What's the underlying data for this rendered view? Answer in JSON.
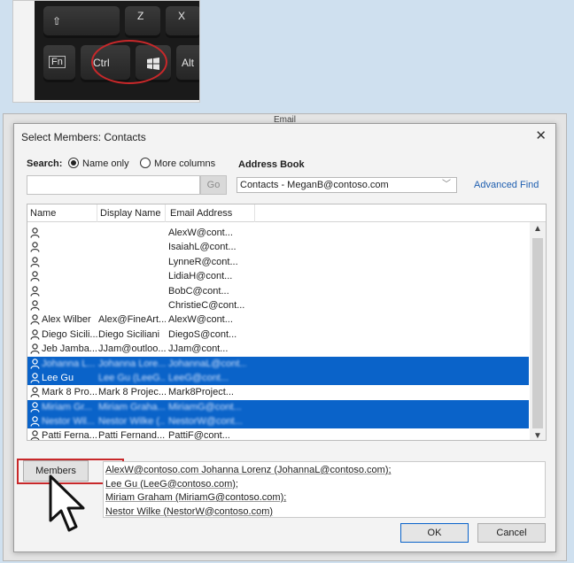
{
  "keyboard": {
    "keys": [
      "⇧",
      "Z",
      "X",
      "Fn",
      "Ctrl",
      "Alt"
    ],
    "win_icon": "windows-logo-icon"
  },
  "background_window": {
    "title": "Email"
  },
  "dialog": {
    "title": "Select Members: Contacts",
    "close_icon": "close-icon",
    "search_label": "Search:",
    "radio_name_only": "Name only",
    "radio_more_columns": "More columns",
    "address_book_label": "Address Book",
    "search_value": "",
    "go_label": "Go",
    "address_book_value": "Contacts - MeganB@contoso.com",
    "advanced_find": "Advanced Find",
    "columns": [
      "Name",
      "Display Name",
      "Email Address"
    ],
    "rows": [
      {
        "name": "",
        "display": "",
        "email": "AlexW@cont...",
        "selected": false
      },
      {
        "name": "",
        "display": "",
        "email": "IsaiahL@cont...",
        "selected": false
      },
      {
        "name": "",
        "display": "",
        "email": "LynneR@cont...",
        "selected": false
      },
      {
        "name": "",
        "display": "",
        "email": "LidiaH@cont...",
        "selected": false
      },
      {
        "name": "",
        "display": "",
        "email": "BobC@cont...",
        "selected": false
      },
      {
        "name": "",
        "display": "",
        "email": "ChristieC@cont...",
        "selected": false
      },
      {
        "name": "Alex Wilber",
        "display": "Alex@FineArt...",
        "email": "AlexW@cont...",
        "selected": false
      },
      {
        "name": "Diego Sicili...",
        "display": "Diego Siciliani",
        "email": "DiegoS@cont...",
        "selected": false
      },
      {
        "name": "Jeb Jamba...",
        "display": "JJam@outloo...",
        "email": "JJam@cont...",
        "selected": false
      },
      {
        "name": "Johanna L...",
        "display": "Johanna Lore...",
        "email": "JohannaL@cont...",
        "selected": true,
        "clear": false
      },
      {
        "name": "Lee Gu",
        "display": "Lee Gu (LeeG...",
        "email": "LeeG@cont...",
        "selected": true,
        "clear": true
      },
      {
        "name": "Mark 8 Pro...",
        "display": "Mark 8 Projec...",
        "email": "Mark8Project...",
        "selected": false
      },
      {
        "name": "Miriam Gr...",
        "display": "Miriam Graha...",
        "email": "MiriamG@cont...",
        "selected": true,
        "clear": false
      },
      {
        "name": "Nestor Wil...",
        "display": "Nestor Wilke (...",
        "email": "NestorW@cont...",
        "selected": true,
        "clear": false
      },
      {
        "name": "Patti Ferna...",
        "display": "Patti Fernand...",
        "email": "PattiF@cont...",
        "selected": false
      }
    ],
    "members_button": "Members",
    "members_lines": [
      "AlexW@contoso.com  Johanna Lorenz (JohannaL@contoso.com);",
      "Lee Gu (LeeG@contoso.com);",
      "Miriam Graham (MiriamG@contoso.com);",
      "Nestor Wilke (NestorW@contoso.com)"
    ],
    "ok_label": "OK",
    "cancel_label": "Cancel"
  },
  "colors": {
    "selection": "#0a63c9",
    "highlight_ring": "#c8282a",
    "link": "#1f5fb0"
  }
}
